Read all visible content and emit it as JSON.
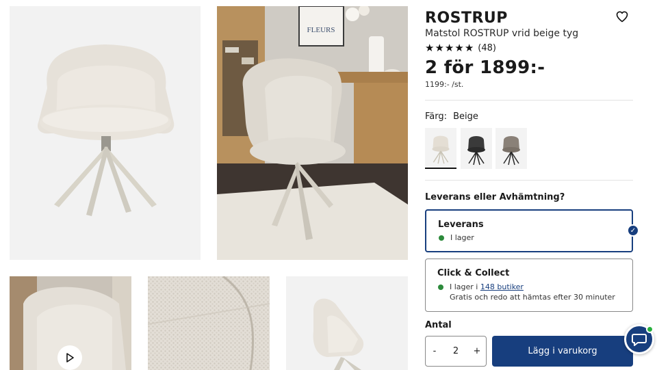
{
  "product": {
    "title": "ROSTRUP",
    "subtitle": "Matstol ROSTRUP vrid beige tyg",
    "rating_stars": 5,
    "rating_count": "(48)",
    "price": "2 för 1899:-",
    "unit_price": "1199:- /st."
  },
  "color": {
    "label": "Färg:",
    "selected": "Beige",
    "swatches": [
      "beige-chair",
      "black-chair",
      "grey-chair"
    ]
  },
  "delivery": {
    "question": "Leverans eller Avhämtning?",
    "options": [
      {
        "title": "Leverans",
        "status": "I lager"
      },
      {
        "title": "Click & Collect",
        "status_prefix": "I lager i",
        "stores_link": "148 butiker",
        "note": "Gratis och redo att hämtas efter 30 minuter"
      }
    ]
  },
  "quantity": {
    "label": "Antal",
    "minus": "-",
    "value": "2",
    "plus": "+"
  },
  "cart": {
    "button_label": "Lägg i varukorg"
  },
  "gallery": {
    "images": [
      "chair-front-studio",
      "chair-lifestyle-table",
      "chair-video-thumb",
      "fabric-closeup",
      "chair-side-studio"
    ],
    "poster_text": "FLEURS"
  },
  "colors": {
    "accent": "#173e7e",
    "stock": "#2c8a3b",
    "chat_online": "#27b03d"
  }
}
